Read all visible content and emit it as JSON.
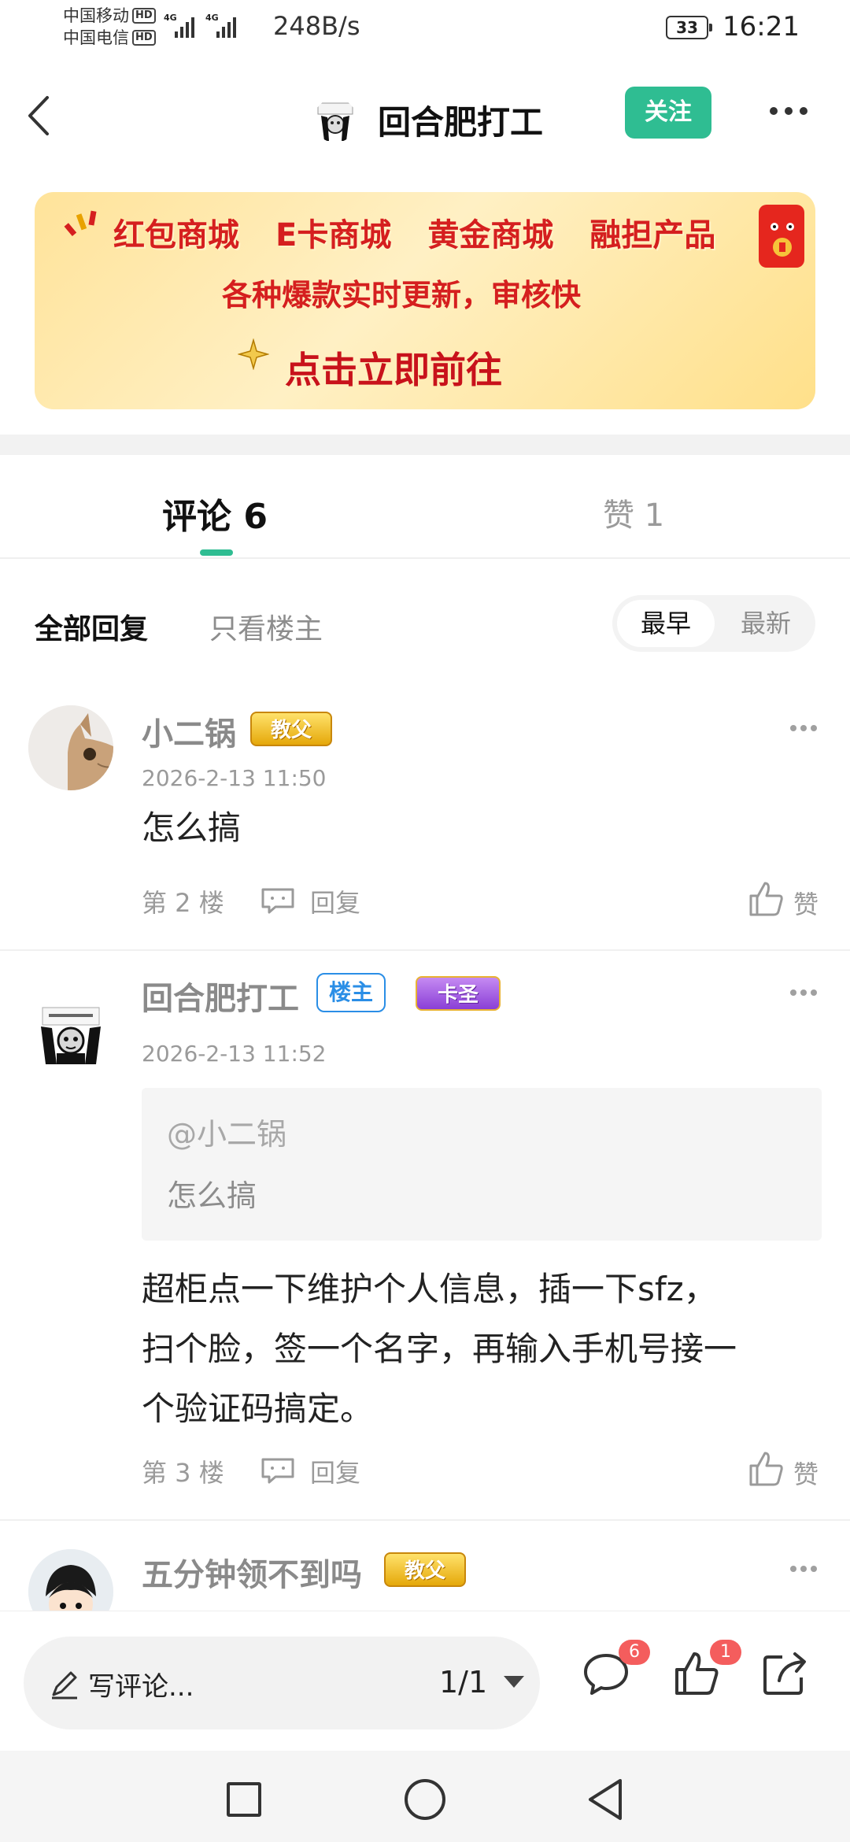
{
  "status_bar": {
    "carrier1": "中国移动",
    "carrier2": "中国电信",
    "hd": "HD",
    "net": "4G",
    "net_speed": "248B/s",
    "battery": "33",
    "time": "16:21"
  },
  "header": {
    "title": "回合肥打工",
    "follow_label": "关注"
  },
  "banner": {
    "items": [
      "红包商城",
      "E卡商城",
      "黄金商城",
      "融担产品"
    ],
    "subtitle": "各种爆款实时更新，审核快",
    "cta": "点击立即前往"
  },
  "tabs": {
    "comments_label": "评论 6",
    "likes_label": "赞 1"
  },
  "filters": {
    "all": "全部回复",
    "op_only": "只看楼主",
    "sort_earliest": "最早",
    "sort_newest": "最新"
  },
  "comments": [
    {
      "name": "小二锅",
      "badge": "教父",
      "time": "2026-2-13 11:50",
      "text": "怎么搞",
      "floor": "第 2 楼",
      "reply": "回复",
      "like": "赞"
    },
    {
      "name": "回合肥打工",
      "owner_badge": "楼主",
      "badge": "卡圣",
      "time": "2026-2-13 11:52",
      "quote_user": "@小二锅",
      "quote_text": "怎么搞",
      "text_lines": [
        "超柜点一下维护个人信息，插一下sfz，",
        "扫个脸，签一个名字，再输入手机号接一",
        "个验证码搞定。"
      ],
      "floor": "第 3 楼",
      "reply": "回复",
      "like": "赞"
    },
    {
      "name": "五分钟领不到吗",
      "badge": "教父"
    }
  ],
  "bottom_bar": {
    "write_placeholder": "写评论...",
    "page_indicator": "1/1",
    "comment_count": "6",
    "like_count": "1"
  },
  "colors": {
    "accent": "#2fbd92",
    "badge_red": "#f45d5d",
    "banner_red": "#d51f1f",
    "owner_blue": "#2a8ee6"
  }
}
